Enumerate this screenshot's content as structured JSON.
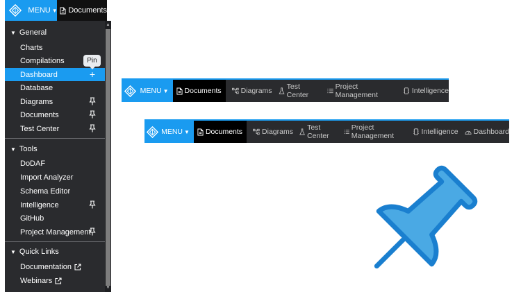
{
  "top_bar": {
    "menu_label": "MENU",
    "active_label": "Documents"
  },
  "sidebar": {
    "sections": [
      {
        "title": "General",
        "items": [
          "Charts",
          "Compilations",
          "Dashboard",
          "Database",
          "Diagrams",
          "Documents",
          "Test Center"
        ]
      },
      {
        "title": "Tools",
        "items": [
          "DoDAF",
          "Import Analyzer",
          "Schema Editor",
          "Intelligence",
          "GitHub",
          "Project Management"
        ]
      },
      {
        "title": "Quick Links",
        "items": [
          "Documentation",
          "Webinars"
        ]
      }
    ],
    "active_item": "Dashboard",
    "tooltip": "Pin"
  },
  "navbar_before": {
    "menu_label": "MENU",
    "items": [
      "Documents",
      "Diagrams",
      "Test Center",
      "Project Management",
      "Intelligence"
    ]
  },
  "navbar_after": {
    "menu_label": "MENU",
    "items": [
      "Documents",
      "Diagrams",
      "Test Center",
      "Project Management",
      "Intelligence",
      "Dashboard"
    ]
  },
  "colors": {
    "accent": "#1a9bf0",
    "panel": "#2a2b2e",
    "active_tab": "#000000"
  },
  "icons": {
    "logo": "diamond-logo-icon",
    "pin": "pin-icon",
    "plus": "plus-icon",
    "external": "external-link-icon",
    "document": "document-icon",
    "diagram": "diagram-icon",
    "flask": "flask-icon",
    "list": "list-icon",
    "chip": "intelligence-icon",
    "gauge": "dashboard-icon"
  }
}
